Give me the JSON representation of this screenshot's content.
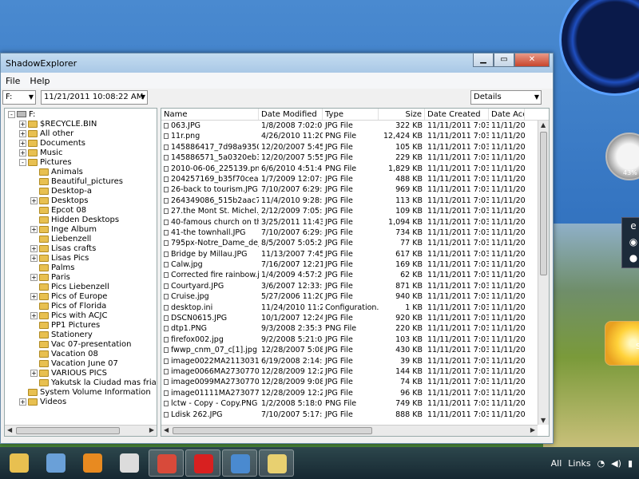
{
  "window": {
    "title": "ShadowExplorer"
  },
  "menu": [
    "File",
    "Help"
  ],
  "toolbar": {
    "drive": "F:",
    "snapshot": "11/21/2011 10:08:22 AM",
    "view": "Details"
  },
  "tree": [
    {
      "label": "F:",
      "level": 0,
      "expander": "-",
      "icon": "drive"
    },
    {
      "label": "$RECYCLE.BIN",
      "level": 1,
      "expander": "+"
    },
    {
      "label": "All other",
      "level": 1,
      "expander": "+"
    },
    {
      "label": "Documents",
      "level": 1,
      "expander": "+"
    },
    {
      "label": "Music",
      "level": 1,
      "expander": "+"
    },
    {
      "label": "Pictures",
      "level": 1,
      "expander": "-"
    },
    {
      "label": "Animals",
      "level": 2,
      "expander": ""
    },
    {
      "label": "Beautiful_pictures",
      "level": 2,
      "expander": ""
    },
    {
      "label": "Desktop-a",
      "level": 2,
      "expander": ""
    },
    {
      "label": "Desktops",
      "level": 2,
      "expander": "+"
    },
    {
      "label": "Epcot 08",
      "level": 2,
      "expander": ""
    },
    {
      "label": "Hidden Desktops",
      "level": 2,
      "expander": ""
    },
    {
      "label": "Inge Album",
      "level": 2,
      "expander": "+"
    },
    {
      "label": "Liebenzell",
      "level": 2,
      "expander": ""
    },
    {
      "label": "Lisas crafts",
      "level": 2,
      "expander": "+"
    },
    {
      "label": "Lisas Pics",
      "level": 2,
      "expander": "+"
    },
    {
      "label": "Palms",
      "level": 2,
      "expander": ""
    },
    {
      "label": "Paris",
      "level": 2,
      "expander": "+"
    },
    {
      "label": "Pics Liebenzell",
      "level": 2,
      "expander": ""
    },
    {
      "label": "Pics of Europe",
      "level": 2,
      "expander": "+"
    },
    {
      "label": "Pics of Florida",
      "level": 2,
      "expander": ""
    },
    {
      "label": "Pics with ACJC",
      "level": 2,
      "expander": "+"
    },
    {
      "label": "PP1 Pictures",
      "level": 2,
      "expander": ""
    },
    {
      "label": "Stationery",
      "level": 2,
      "expander": ""
    },
    {
      "label": "Vac 07-presentation",
      "level": 2,
      "expander": ""
    },
    {
      "label": "Vacation 08",
      "level": 2,
      "expander": ""
    },
    {
      "label": "Vacation June 07",
      "level": 2,
      "expander": ""
    },
    {
      "label": "VARIOUS PICS",
      "level": 2,
      "expander": "+"
    },
    {
      "label": "Yakutsk la Ciudad mas fria del Mun",
      "level": 2,
      "expander": ""
    },
    {
      "label": "System Volume Information",
      "level": 1,
      "expander": ""
    },
    {
      "label": "Videos",
      "level": 1,
      "expander": "+"
    }
  ],
  "list": {
    "columns": [
      "Name",
      "Date Modified",
      "Type",
      "Size",
      "Date Created",
      "Date Acce"
    ],
    "rows": [
      [
        "063.JPG",
        "1/8/2008 7:02:06 ...",
        "JPG File",
        "322 KB",
        "11/11/2011 7:03:...",
        "11/11/2011"
      ],
      [
        "11r.png",
        "4/26/2010 11:20:...",
        "PNG File",
        "12,424 KB",
        "11/11/2011 7:03:...",
        "11/11/2011"
      ],
      [
        "145886417_7d98a93508[...",
        "12/20/2007 5:45:...",
        "JPG File",
        "105 KB",
        "11/11/2011 7:03:...",
        "11/11/2011"
      ],
      [
        "145886571_5a0320eb36[...",
        "12/20/2007 5:55:...",
        "JPG File",
        "229 KB",
        "11/11/2011 7:03:...",
        "11/11/2011"
      ],
      [
        "2010-06-06_225139.png",
        "6/6/2010 4:51:43 ...",
        "PNG File",
        "1,829 KB",
        "11/11/2011 7:03:...",
        "11/11/2011"
      ],
      [
        "204257169_b35f70cea4[...",
        "1/7/2009 12:07:1...",
        "JPG File",
        "488 KB",
        "11/11/2011 7:03:...",
        "11/11/2011"
      ],
      [
        "26-back to tourism.JPG",
        "7/10/2007 6:29:3...",
        "JPG File",
        "969 KB",
        "11/11/2011 7:03:...",
        "11/11/2011"
      ],
      [
        "264349086_515b2aac78[...",
        "11/4/2010 9:28:1...",
        "JPG File",
        "113 KB",
        "11/11/2011 7:03:...",
        "11/11/2011"
      ],
      [
        "27.the Mont St. Michel.JPG",
        "2/12/2009 7:05:1...",
        "JPG File",
        "109 KB",
        "11/11/2011 7:03:...",
        "11/11/2011"
      ],
      [
        "40-famous church on the ...",
        "3/25/2011 11:43:...",
        "JPG File",
        "1,094 KB",
        "11/11/2011 7:03:...",
        "11/11/2011"
      ],
      [
        "41-the townhall.JPG",
        "7/10/2007 6:29:4...",
        "JPG File",
        "734 KB",
        "11/11/2011 7:03:...",
        "11/11/2011"
      ],
      [
        "795px-Notre_Dame_de_...",
        "8/5/2007 5:05:24 ...",
        "JPG File",
        "77 KB",
        "11/11/2011 7:03:...",
        "11/11/2011"
      ],
      [
        "Bridge by Millau.JPG",
        "11/13/2007 7:45:...",
        "JPG File",
        "617 KB",
        "11/11/2011 7:03:...",
        "11/11/2011"
      ],
      [
        "Calw.jpg",
        "7/16/2007 12:21:...",
        "JPG File",
        "169 KB",
        "11/11/2011 7:03:...",
        "11/11/2011"
      ],
      [
        "Corrected fire rainbow.jpg",
        "1/4/2009 4:57:24 ...",
        "JPG File",
        "62 KB",
        "11/11/2011 7:03:...",
        "11/11/2011"
      ],
      [
        "Courtyard.JPG",
        "3/6/2007 12:33:5...",
        "JPG File",
        "871 KB",
        "11/11/2011 7:03:...",
        "11/11/2011"
      ],
      [
        "Cruise.jpg",
        "5/27/2006 11:20:...",
        "JPG File",
        "940 KB",
        "11/11/2011 7:03:...",
        "11/11/2011"
      ],
      [
        "desktop.ini",
        "11/24/2010 11:28:...",
        "Configuration...",
        "1 KB",
        "11/11/2011 7:03:...",
        "11/11/2011"
      ],
      [
        "DSCN0615.JPG",
        "10/1/2007 12:24:...",
        "JPG File",
        "920 KB",
        "11/11/2011 7:03:...",
        "11/11/2011"
      ],
      [
        "dtp1.PNG",
        "9/3/2008 2:35:30 ...",
        "PNG File",
        "220 KB",
        "11/11/2011 7:03:...",
        "11/11/2011"
      ],
      [
        "firefox002.jpg",
        "9/2/2008 5:21:04 ...",
        "JPG File",
        "103 KB",
        "11/11/2011 7:03:...",
        "11/11/2011"
      ],
      [
        "fwwp_cnm_07_c[1].jpg",
        "12/28/2007 5:08:...",
        "JPG File",
        "430 KB",
        "11/11/2011 7:03:...",
        "11/11/2011"
      ],
      [
        "image0022MA21130315-...",
        "6/19/2008 2:14:0...",
        "JPG File",
        "39 KB",
        "11/11/2011 7:03:...",
        "11/11/2011"
      ],
      [
        "image0066MA27307707-...",
        "12/28/2009 12:29:...",
        "JPG File",
        "144 KB",
        "11/11/2011 7:03:...",
        "11/11/2011"
      ],
      [
        "image0099MA27307707-...",
        "12/28/2009 9:08:...",
        "JPG File",
        "74 KB",
        "11/11/2011 7:03:...",
        "11/11/2011"
      ],
      [
        "image01111MA2730770...",
        "12/28/2009 12:29:...",
        "JPG File",
        "96 KB",
        "11/11/2011 7:03:...",
        "11/11/2011"
      ],
      [
        "lctw - Copy - Copy.PNG",
        "1/2/2008 5:18:02 ...",
        "PNG File",
        "749 KB",
        "11/11/2011 7:03:...",
        "11/11/2011"
      ],
      [
        "Ldisk 262.JPG",
        "7/10/2007 5:17:3...",
        "JPG File",
        "888 KB",
        "11/11/2011 7:03:...",
        "11/11/2011"
      ]
    ]
  },
  "desktop": {
    "gauge_pct": "43%",
    "sun_text": "S"
  },
  "taskbar": {
    "buttons": [
      {
        "name": "explorer",
        "color": "#e8c050",
        "active": false
      },
      {
        "name": "app",
        "color": "#6aa0d8",
        "active": false
      },
      {
        "name": "media",
        "color": "#e88a20",
        "active": false
      },
      {
        "name": "window",
        "color": "#dcdcdc",
        "active": false
      },
      {
        "name": "chrome",
        "color": "#d84a3a",
        "active": true
      },
      {
        "name": "opera",
        "color": "#d82020",
        "active": true
      },
      {
        "name": "safari",
        "color": "#4a8ad0",
        "active": true
      },
      {
        "name": "shadowexplorer",
        "color": "#e8d070",
        "active": true
      }
    ],
    "tray": [
      "All",
      "Links"
    ]
  }
}
